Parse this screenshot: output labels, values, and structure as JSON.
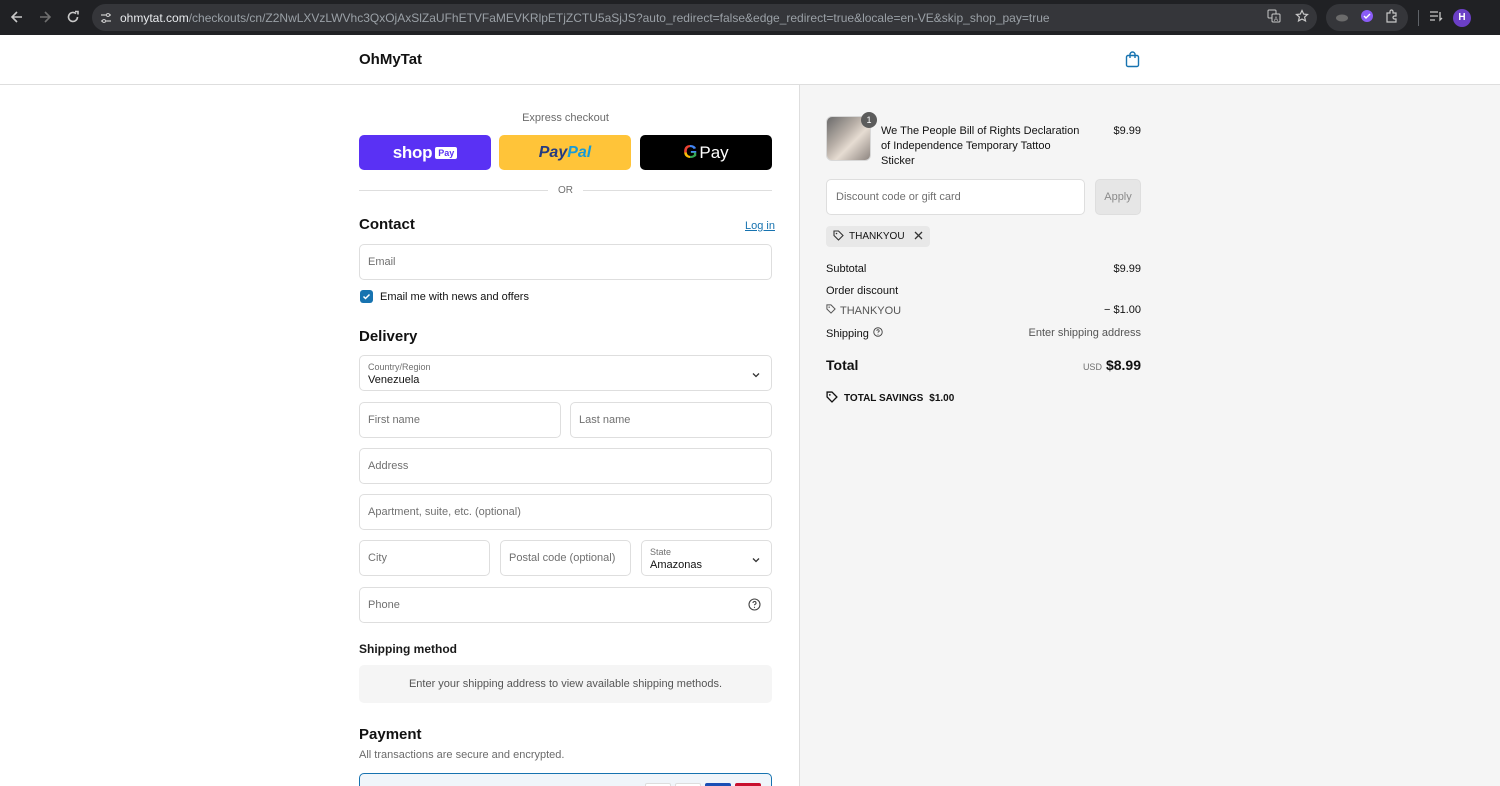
{
  "browser": {
    "url_host": "ohmytat.com",
    "url_path": "/checkouts/cn/Z2NwLXVzLWVhc3QxOjAxSlZaUFhETVFaMEVKRlpETjZCTU5aSjJS?auto_redirect=false&edge_redirect=true&locale=en-VE&skip_shop_pay=true",
    "profile_initial": "H"
  },
  "header": {
    "brand": "OhMyTat"
  },
  "express": {
    "label": "Express checkout",
    "shop_word": "shop",
    "shop_badge": "Pay",
    "paypal_a": "Pay",
    "paypal_b": "Pal",
    "gpay_g": "G",
    "gpay_word": "Pay",
    "or_text": "OR"
  },
  "contact": {
    "title": "Contact",
    "login": "Log in",
    "email_placeholder": "Email",
    "newsletter_label": "Email me with news and offers",
    "newsletter_checked": true
  },
  "delivery": {
    "title": "Delivery",
    "country_label": "Country/Region",
    "country_value": "Venezuela",
    "first_name": "First name",
    "last_name": "Last name",
    "address": "Address",
    "apartment": "Apartment, suite, etc. (optional)",
    "city": "City",
    "postal": "Postal code (optional)",
    "state_label": "State",
    "state_value": "Amazonas",
    "phone": "Phone"
  },
  "shipping_method": {
    "title": "Shipping method",
    "message": "Enter your shipping address to view available shipping methods."
  },
  "payment": {
    "title": "Payment",
    "subtitle": "All transactions are secure and encrypted."
  },
  "summary": {
    "product_name": "We The People Bill of Rights Declaration of Independence Temporary Tattoo Sticker",
    "product_price": "$9.99",
    "quantity": "1",
    "discount_placeholder": "Discount code or gift card",
    "apply": "Apply",
    "applied_code": "THANKYOU",
    "subtotal_label": "Subtotal",
    "subtotal_value": "$9.99",
    "order_discount_label": "Order discount",
    "discount_code": "THANKYOU",
    "discount_value": "− $1.00",
    "shipping_label": "Shipping",
    "shipping_value": "Enter shipping address",
    "total_label": "Total",
    "currency": "USD",
    "total_value": "$8.99",
    "savings_label": "TOTAL SAVINGS",
    "savings_value": "$1.00"
  },
  "colors": {
    "accent": "#1773b0",
    "shop_pay": "#5a31f4",
    "paypal": "#ffc439",
    "gpay": "#000000"
  }
}
